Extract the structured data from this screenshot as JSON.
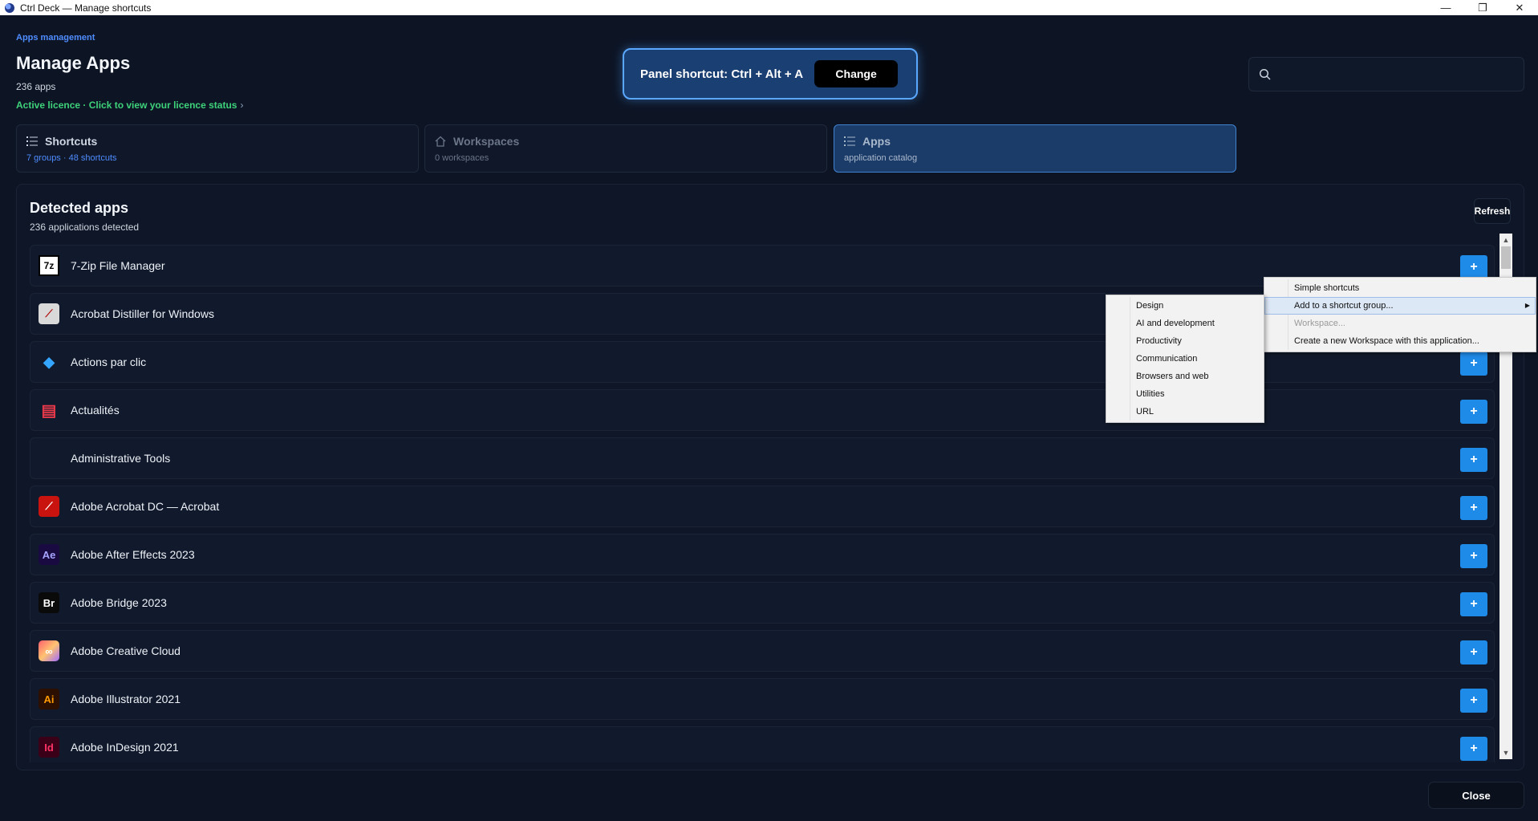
{
  "window": {
    "title": "Ctrl Deck — Manage shortcuts",
    "minimize": "—",
    "restore": "❐",
    "close": "✕"
  },
  "header": {
    "breadcrumb": "Apps management",
    "title": "Manage Apps",
    "app_count": "236 apps",
    "licence": "Active licence · Click to view your licence status",
    "licence_chevron": "›"
  },
  "panel_shortcut": {
    "label": "Panel shortcut: Ctrl + Alt + A",
    "change": "Change"
  },
  "search": {
    "placeholder": "",
    "value": ""
  },
  "tabs": [
    {
      "title": "Shortcuts",
      "subtitle": "7 groups · 48 shortcuts",
      "active": false
    },
    {
      "title": "Workspaces",
      "subtitle": "0 workspaces",
      "active": false
    },
    {
      "title": "Apps",
      "subtitle": "application catalog",
      "active": true
    }
  ],
  "detected": {
    "title": "Detected apps",
    "subtitle": "236 applications detected",
    "refresh": "Refresh"
  },
  "apps": [
    {
      "name": "7-Zip File Manager",
      "icon": "7zip-icon",
      "glyph": "7z"
    },
    {
      "name": "Acrobat  Distiller for Windows",
      "icon": "acrobat-distiller-icon",
      "glyph": "⟋"
    },
    {
      "name": "Actions par clic",
      "icon": "actions-par-clic-icon",
      "glyph": "◆"
    },
    {
      "name": "Actualités",
      "icon": "news-icon",
      "glyph": "▤"
    },
    {
      "name": "Administrative Tools",
      "icon": "",
      "glyph": ""
    },
    {
      "name": "Adobe Acrobat DC — Acrobat",
      "icon": "adobe-acrobat-icon",
      "glyph": "⟋"
    },
    {
      "name": "Adobe After Effects 2023",
      "icon": "after-effects-icon",
      "glyph": "Ae"
    },
    {
      "name": "Adobe Bridge 2023",
      "icon": "bridge-icon",
      "glyph": "Br"
    },
    {
      "name": "Adobe Creative Cloud",
      "icon": "creative-cloud-icon",
      "glyph": "∞"
    },
    {
      "name": "Adobe Illustrator 2021",
      "icon": "illustrator-icon",
      "glyph": "Ai"
    },
    {
      "name": "Adobe InDesign 2021",
      "icon": "indesign-icon",
      "glyph": "Id"
    }
  ],
  "add_label": "+",
  "context_menu": {
    "items": [
      "Simple shortcuts",
      "Add to a shortcut group...",
      "Workspace...",
      "Create a new Workspace with this application..."
    ],
    "selected_index": 1,
    "disabled_index": 2
  },
  "group_submenu": {
    "items": [
      "Design",
      "AI and development",
      "Productivity",
      "Communication",
      "Browsers and web",
      "Utilities",
      "URL"
    ]
  },
  "footer": {
    "close": "Close"
  },
  "colors": {
    "background": "#0d1525",
    "accent": "#1f8be8",
    "link": "#4f8cff",
    "licence_green": "#3ed27a"
  }
}
